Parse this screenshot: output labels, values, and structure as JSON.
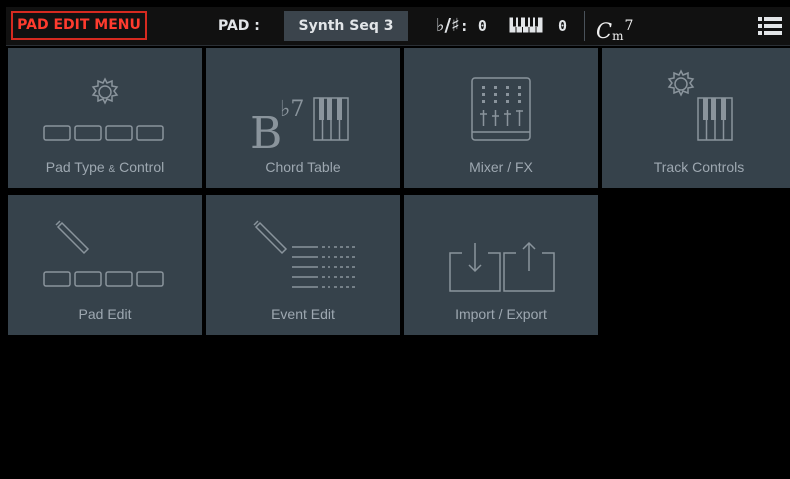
{
  "header": {
    "menu_title": "PAD EDIT MENU",
    "pad_label": "PAD :",
    "pad_name": "Synth Seq 3",
    "transpose_value": "0",
    "octave_value": "0",
    "chord_root": "C",
    "chord_quality": "m",
    "chord_extension": "7"
  },
  "tiles": {
    "pad_type": {
      "label_main": "Pad Type ",
      "label_amp": "&",
      "label_end": " Control"
    },
    "chord_table": {
      "label": "Chord Table",
      "icon_text": "B",
      "icon_sup": "♭7"
    },
    "mixer_fx": {
      "label": "Mixer / FX"
    },
    "track_controls": {
      "label": "Track Controls"
    },
    "pad_edit": {
      "label": "Pad Edit"
    },
    "event_edit": {
      "label": "Event Edit"
    },
    "import_export": {
      "label": "Import / Export"
    }
  },
  "colors": {
    "accent_red": "#d62a20",
    "tile_bg": "#36424b",
    "icon_stroke": "#8a949c"
  }
}
